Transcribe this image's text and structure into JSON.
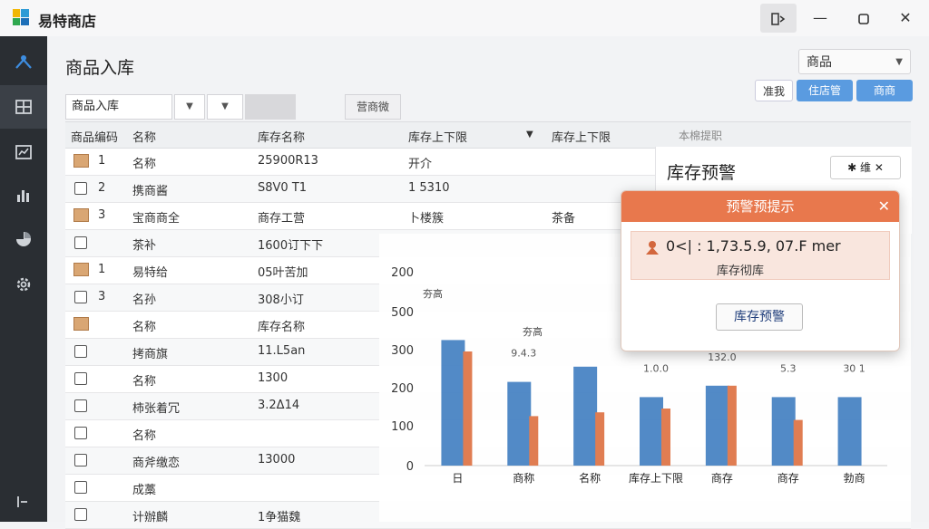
{
  "window": {
    "title": "易特商店",
    "controls": [
      "minimize",
      "maximize",
      "close"
    ]
  },
  "sidebar": {
    "items": [
      {
        "icon": "people-icon",
        "active": false
      },
      {
        "icon": "table-icon",
        "active": true
      },
      {
        "icon": "calendar-chart-icon",
        "active": false
      },
      {
        "icon": "bar-chart-icon",
        "active": false
      },
      {
        "icon": "pie-chart-icon",
        "active": false
      },
      {
        "icon": "gear-icon",
        "active": false
      },
      {
        "icon": "exit-icon",
        "active": false
      }
    ]
  },
  "header": {
    "page_title": "商品入库",
    "category_select": "商品",
    "buttons": [
      "准我",
      "住店管",
      "商商"
    ]
  },
  "filter": {
    "input_value": "商品入库",
    "search_button": "营商微"
  },
  "table": {
    "columns": [
      "商品编码",
      "名称",
      "库存名称",
      "库存上下限",
      "库存上下限",
      "本棉提职"
    ],
    "rows": [
      {
        "icon": "box",
        "code": "1",
        "name": "名称",
        "stock_name": "25900R13",
        "limit": "开介"
      },
      {
        "icon": "checkbox",
        "code": "2",
        "name": "携商酱",
        "stock_name": "S8V0 T1",
        "limit": "1 5310"
      },
      {
        "icon": "box",
        "code": "3",
        "name": "宝商商全",
        "stock_name": "商存工营",
        "limit": "卜楼簇",
        "extra": "茶备"
      },
      {
        "icon": "checkbox",
        "code": "",
        "name": "茶补",
        "stock_name": "1600订下下",
        "limit": ""
      },
      {
        "icon": "box",
        "code": "1",
        "name": "易特给",
        "stock_name": "05叶苦加",
        "limit": ""
      },
      {
        "icon": "checkbox",
        "code": "3",
        "name": "名孙",
        "stock_name": "308小订",
        "limit": ""
      },
      {
        "icon": "box",
        "code": "",
        "name": "名称",
        "stock_name": "库存名称",
        "limit": ""
      },
      {
        "icon": "checkbox",
        "code": "",
        "name": "拷商旗",
        "stock_name": "11.L5an",
        "limit": ""
      },
      {
        "icon": "checkbox",
        "code": "",
        "name": "名称",
        "stock_name": "1300",
        "limit": ""
      },
      {
        "icon": "checkbox",
        "code": "",
        "name": "柿张着冗",
        "stock_name": "3.2Δ14",
        "limit": ""
      },
      {
        "icon": "checkbox",
        "code": "",
        "name": "名称",
        "stock_name": "",
        "limit": ""
      },
      {
        "icon": "checkbox",
        "code": "",
        "name": "商斧缴恋",
        "stock_name": "13000",
        "limit": ""
      },
      {
        "icon": "checkbox",
        "code": "",
        "name": "成藁",
        "stock_name": "",
        "limit": ""
      },
      {
        "icon": "checkbox",
        "code": "",
        "name": "计辦麟",
        "stock_name": "1争猫魏",
        "limit": ""
      }
    ]
  },
  "side_panel": {
    "title": "库存预警",
    "button": "维"
  },
  "alert": {
    "title": "预警预提示",
    "line": "0<| : 1,73.5.9, 07.F mer",
    "sub": "库存彻库",
    "button": "库存预警"
  },
  "chart_data": {
    "type": "bar",
    "ylim": [
      0,
      500
    ],
    "yticks": [
      "0",
      "100",
      "200",
      "300",
      "500",
      "200"
    ],
    "categories": [
      "日",
      "商称",
      "名称",
      "库存上下限",
      "商存",
      "商存",
      "勃商"
    ],
    "series": [
      {
        "color": "#4f88c6",
        "values": [
          330,
          220,
          260,
          180,
          210,
          180,
          180
        ]
      },
      {
        "color": "#e07b4f",
        "values": [
          300,
          130,
          140,
          150,
          210,
          120,
          0
        ]
      }
    ],
    "data_labels": [
      "",
      "9.4.3",
      "",
      "1.0.0",
      "132.0",
      "5.3",
      "30 1"
    ],
    "annotations": [
      "夯高",
      "夯高"
    ],
    "colors": {
      "primary": "#4f88c6",
      "accent": "#e07b4f"
    }
  }
}
